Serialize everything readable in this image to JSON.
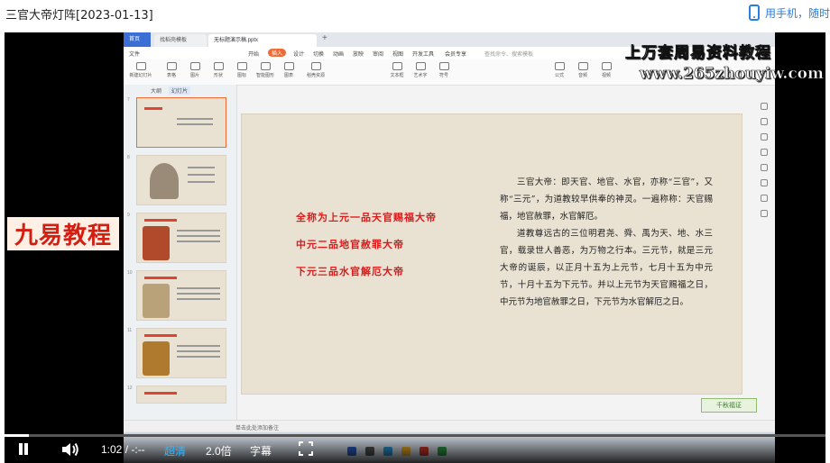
{
  "page": {
    "title": "三官大帝灯阵[2023-01-13]",
    "phone_link": "用手机，随时"
  },
  "wps": {
    "tabs": [
      "首页",
      "找稻壳模板",
      "无标题演示稿.pptx"
    ],
    "menu": [
      "文件",
      "开始",
      "插入",
      "设计",
      "切换",
      "动画",
      "放映",
      "审阅",
      "视图",
      "开发工具",
      "会员专享"
    ],
    "search_placeholder": "查找命令、搜索模板",
    "ribbon": [
      "新建幻灯片",
      "表格",
      "图片",
      "形状",
      "图标",
      "智能图形",
      "图表",
      "稻壳资源",
      "文本框",
      "艺术字",
      "符号",
      "公式",
      "音频",
      "视频"
    ],
    "pane_tabs": [
      "大纲",
      "幻灯片"
    ],
    "thumbnail_numbers": [
      "7",
      "8",
      "9",
      "10",
      "11",
      "12"
    ],
    "add_slide_glyph": "+",
    "status_notes": "单击此处添加备注",
    "stamp": "千秋福证"
  },
  "slide": {
    "red_lines": [
      "全称为上元一品天官赐福大帝",
      "中元二品地官赦罪大帝",
      "下元三品水官解厄大帝"
    ],
    "paragraphs": [
      "三官大帝：即天官、地官、水官，亦称“三官”，又称“三元”，为道教较早供奉的神灵。一遍称称：天官赐福，地官赦罪，水官解厄。",
      "道教尊远古的三位明君尧、舜、禹为天、地、水三官，载录世人善恶，为万物之行本。三元节，就是三元大帝的诞辰，以正月十五为上元节，七月十五为中元节，十月十五为下元节。并以上元节为天官赐福之日，中元节为地官赦罪之日，下元节为水官解厄之日。"
    ]
  },
  "watermarks": {
    "line1": "上万套周易资料教程",
    "line2": "www.265zhouyiw.com",
    "brand": "九易教程"
  },
  "player": {
    "time": "1:02 / -:--",
    "quality": "超清",
    "speed": "2.0倍",
    "subtitles": "字幕",
    "progress": 0.03
  },
  "colors": {
    "accent": "#2a7de1",
    "slide_red": "#e0191a",
    "quality_blue": "#2fb6ff",
    "wps_orange": "#f06a35"
  }
}
